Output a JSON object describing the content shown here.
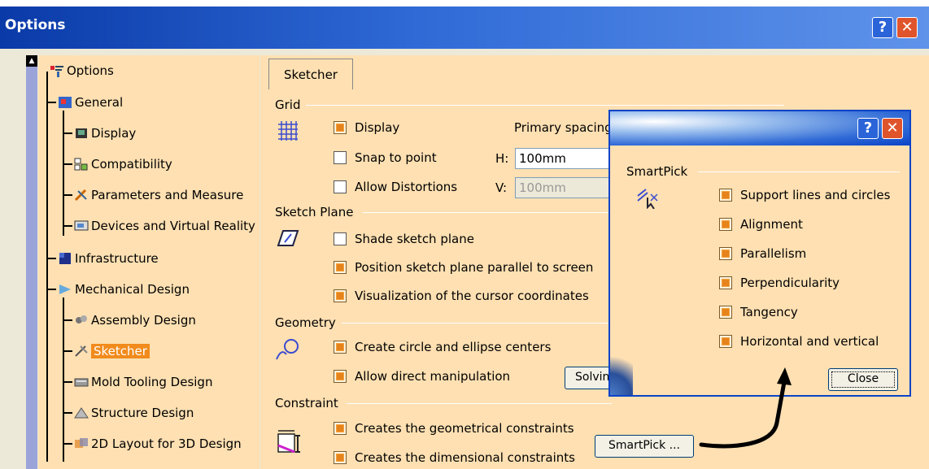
{
  "window": {
    "title": "Options",
    "help_label": "?",
    "close_label": "✕"
  },
  "tree": {
    "items": [
      {
        "label": "Options",
        "icon": "options-icon"
      },
      {
        "label": "General",
        "icon": "general-icon"
      },
      {
        "label": "Display",
        "icon": "display-icon"
      },
      {
        "label": "Compatibility",
        "icon": "compatibility-icon"
      },
      {
        "label": "Parameters and Measure",
        "icon": "parameters-icon"
      },
      {
        "label": "Devices and Virtual Reality",
        "icon": "devices-icon"
      },
      {
        "label": "Infrastructure",
        "icon": "infrastructure-icon"
      },
      {
        "label": "Mechanical Design",
        "icon": "mechanical-design-icon"
      },
      {
        "label": "Assembly Design",
        "icon": "assembly-icon"
      },
      {
        "label": "Sketcher",
        "icon": "sketcher-icon",
        "selected": true
      },
      {
        "label": "Mold Tooling Design",
        "icon": "mold-tooling-icon"
      },
      {
        "label": "Structure Design",
        "icon": "structure-icon"
      },
      {
        "label": "2D Layout for 3D Design",
        "icon": "layout-2d-icon"
      }
    ]
  },
  "tab": {
    "label": "Sketcher"
  },
  "grid": {
    "title": "Grid",
    "display": {
      "label": "Display",
      "checked": true
    },
    "primary_spacing_label": "Primary spacing",
    "snap": {
      "label": "Snap to point",
      "checked": false
    },
    "h_label": "H:",
    "h_value": "100mm",
    "distortions": {
      "label": "Allow Distortions",
      "checked": false
    },
    "v_label": "V:",
    "v_value": "100mm"
  },
  "sketch_plane": {
    "title": "Sketch Plane",
    "shade": {
      "label": "Shade sketch plane",
      "checked": false
    },
    "position": {
      "label": "Position sketch plane parallel to screen",
      "checked": true
    },
    "visualization": {
      "label": "Visualization of the cursor coordinates",
      "checked": true
    }
  },
  "geometry": {
    "title": "Geometry",
    "centers": {
      "label": "Create circle and ellipse centers",
      "checked": true
    },
    "manipulation": {
      "label": "Allow direct manipulation",
      "checked": true
    },
    "solving_button": "Solvin"
  },
  "constraint": {
    "title": "Constraint",
    "geometrical": {
      "label": "Creates the geometrical constraints",
      "checked": true
    },
    "dimensional": {
      "label": "Creates the dimensional constraints",
      "checked": true
    },
    "smartpick_button": "SmartPick ..."
  },
  "smartpick_dialog": {
    "help_label": "?",
    "close_x_label": "✕",
    "group_title": "SmartPick",
    "options": [
      {
        "label": "Support lines and circles",
        "checked": true
      },
      {
        "label": "Alignment",
        "checked": true
      },
      {
        "label": "Parallelism",
        "checked": true
      },
      {
        "label": "Perpendicularity",
        "checked": true
      },
      {
        "label": "Tangency",
        "checked": true
      },
      {
        "label": "Horizontal and vertical",
        "checked": true
      }
    ],
    "close_button": "Close"
  },
  "colors": {
    "panel_bg": "#fee0b2",
    "title_blue": "#0a3aa8",
    "selection": "#f18b1d"
  }
}
